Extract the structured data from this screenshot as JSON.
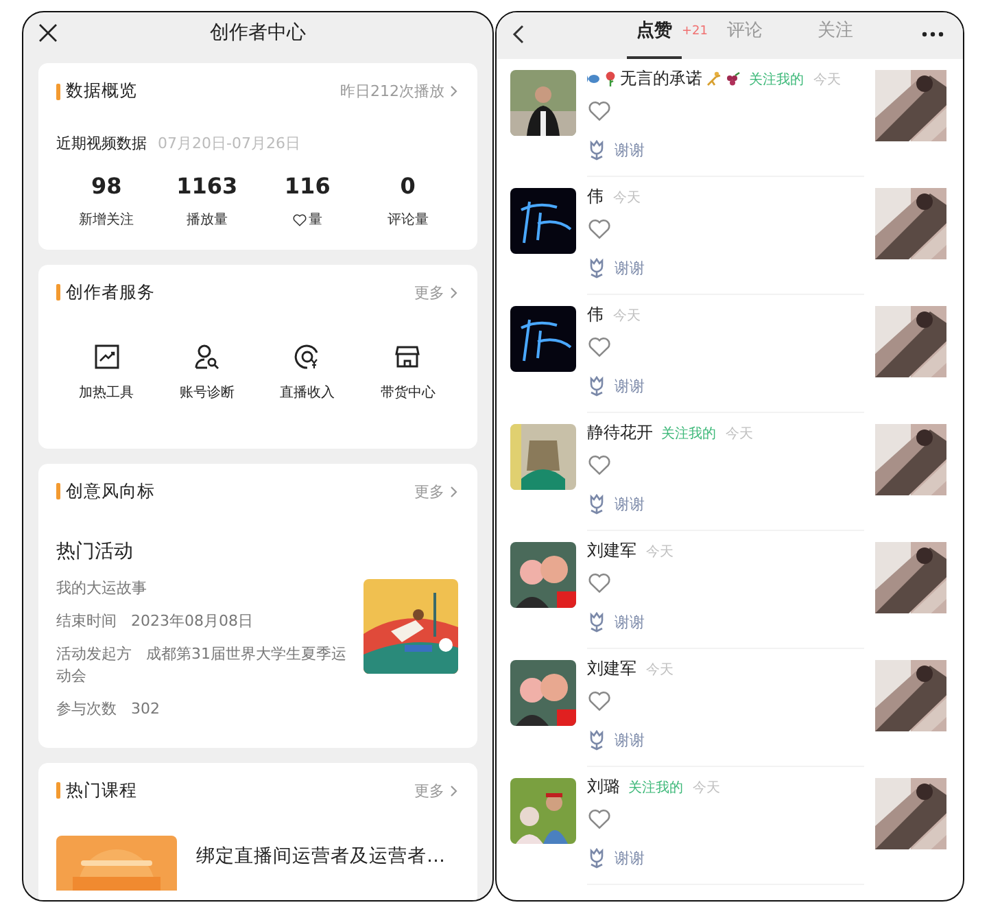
{
  "left_screen": {
    "title": "创作者中心",
    "overview": {
      "heading": "数据概览",
      "link": "昨日212次播放",
      "subheading": "近期视频数据",
      "date_range": "07月20日-07月26日",
      "stats": [
        {
          "value": "98",
          "label": "新增关注",
          "kind": "text"
        },
        {
          "value": "1163",
          "label": "播放量",
          "kind": "text"
        },
        {
          "value": "116",
          "label": "量",
          "kind": "heart"
        },
        {
          "value": "0",
          "label": "评论量",
          "kind": "text"
        }
      ]
    },
    "services": {
      "heading": "创作者服务",
      "more": "更多",
      "items": [
        {
          "label": "加热工具",
          "kind": "chart"
        },
        {
          "label": "账号诊断",
          "kind": "user-search"
        },
        {
          "label": "直播收入",
          "kind": "income"
        },
        {
          "label": "带货中心",
          "kind": "store"
        }
      ]
    },
    "trends": {
      "heading": "创意风向标",
      "more": "更多",
      "activity_title": "热门活动",
      "activity_name": "我的大运故事",
      "fields": [
        {
          "label": "结束时间",
          "value": "2023年08月08日"
        },
        {
          "label": "活动发起方",
          "value": "成都第31届世界大学生夏季运动会"
        },
        {
          "label": "参与次数",
          "value": "302"
        }
      ]
    },
    "courses": {
      "heading": "热门课程",
      "more": "更多",
      "items": [
        {
          "title": "绑定直播间运营者及运营者…"
        }
      ]
    }
  },
  "right_screen": {
    "tabs": [
      {
        "label": "点赞",
        "badge": "+21",
        "selected": true
      },
      {
        "label": "评论",
        "selected": false
      },
      {
        "label": "关注",
        "selected": false
      }
    ],
    "notifications": [
      {
        "name": "无言的承诺",
        "decorated": true,
        "follows_me": true,
        "follow_label": "关注我的",
        "time": "今天",
        "reply": "谢谢"
      },
      {
        "name": "伟",
        "decorated": false,
        "follows_me": false,
        "time": "今天",
        "reply": "谢谢"
      },
      {
        "name": "伟",
        "decorated": false,
        "follows_me": false,
        "time": "今天",
        "reply": "谢谢"
      },
      {
        "name": "静待花开",
        "decorated": false,
        "follows_me": true,
        "follow_label": "关注我的",
        "time": "今天",
        "reply": "谢谢"
      },
      {
        "name": "刘建军",
        "decorated": false,
        "follows_me": false,
        "time": "今天",
        "reply": "谢谢"
      },
      {
        "name": "刘建军",
        "decorated": false,
        "follows_me": false,
        "time": "今天",
        "reply": "谢谢"
      },
      {
        "name": "刘璐",
        "decorated": false,
        "follows_me": true,
        "follow_label": "关注我的",
        "time": "今天",
        "reply": "谢谢"
      }
    ]
  }
}
